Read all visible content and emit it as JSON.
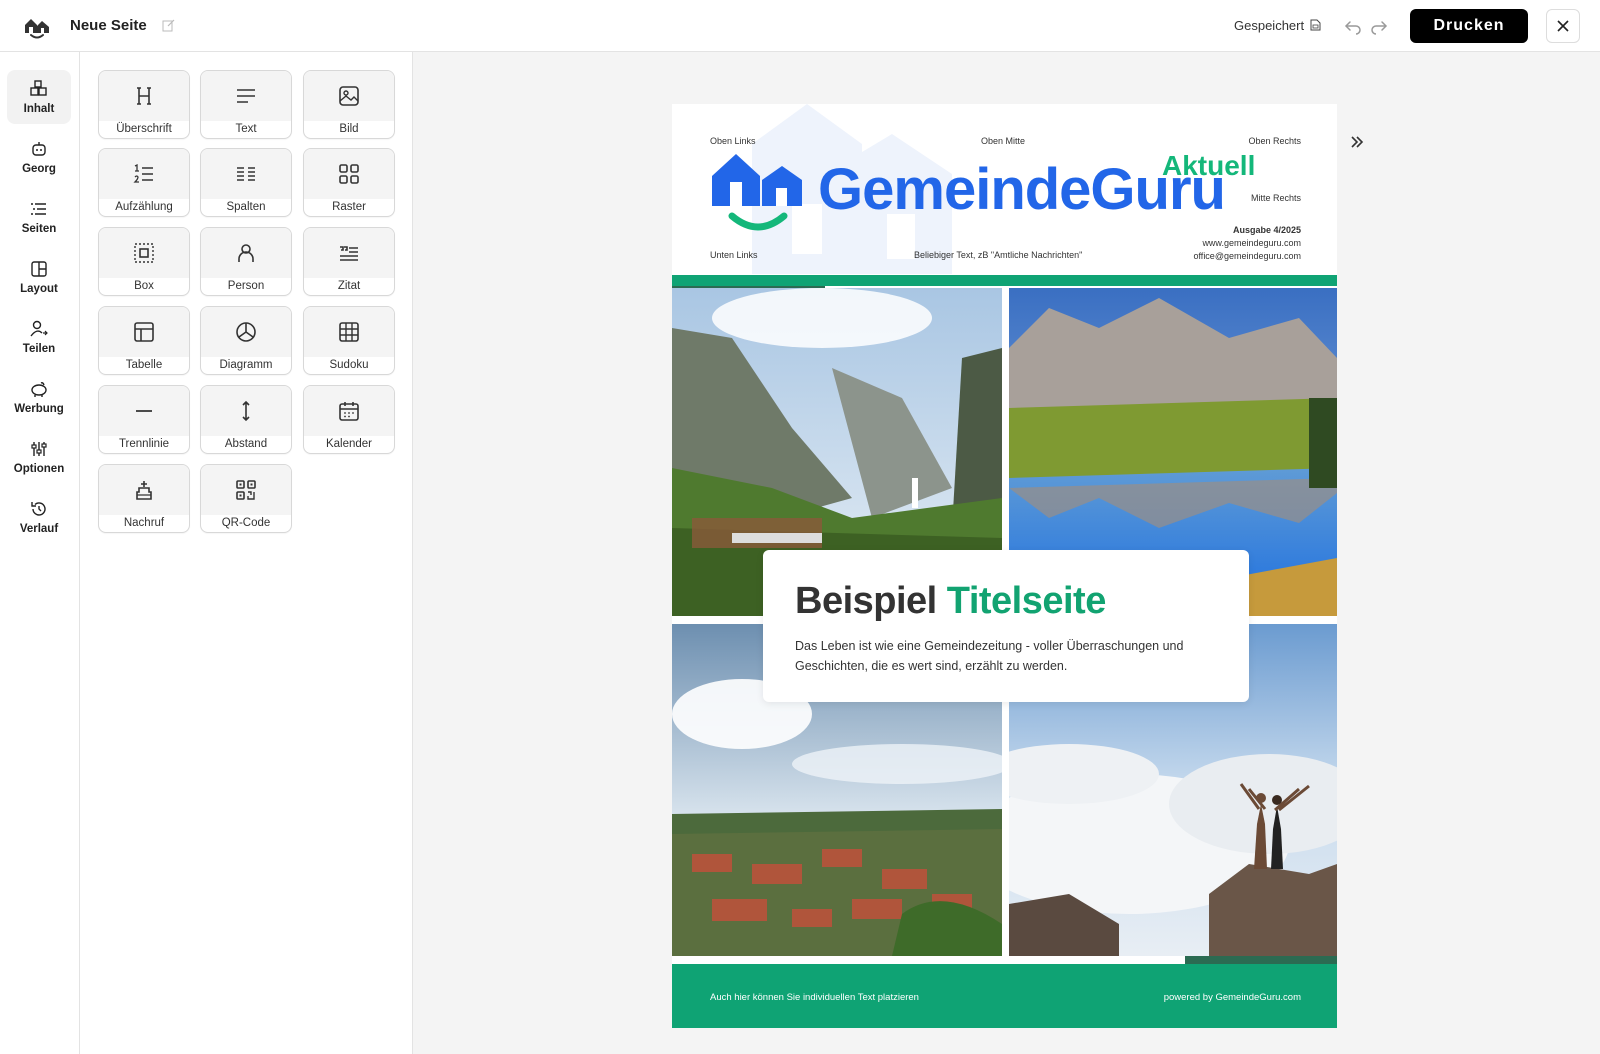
{
  "topbar": {
    "page_title": "Neue Seite",
    "saved_status": "Gespeichert",
    "print_label": "Drucken"
  },
  "rail": {
    "items": [
      {
        "label": "Inhalt",
        "icon": "blocks-icon"
      },
      {
        "label": "Georg",
        "icon": "robot-icon"
      },
      {
        "label": "Seiten",
        "icon": "list-icon"
      },
      {
        "label": "Layout",
        "icon": "layout-icon"
      },
      {
        "label": "Teilen",
        "icon": "user-share-icon"
      },
      {
        "label": "Werbung",
        "icon": "piggy-bank-icon"
      },
      {
        "label": "Optionen",
        "icon": "sliders-icon"
      },
      {
        "label": "Verlauf",
        "icon": "history-icon"
      }
    ]
  },
  "blocks": [
    {
      "label": "Überschrift",
      "icon": "heading-icon"
    },
    {
      "label": "Text",
      "icon": "text-icon"
    },
    {
      "label": "Bild",
      "icon": "image-icon"
    },
    {
      "label": "Aufzählung",
      "icon": "numbered-list-icon"
    },
    {
      "label": "Spalten",
      "icon": "columns-icon"
    },
    {
      "label": "Raster",
      "icon": "grid-icon"
    },
    {
      "label": "Box",
      "icon": "box-icon"
    },
    {
      "label": "Person",
      "icon": "person-icon"
    },
    {
      "label": "Zitat",
      "icon": "quote-icon"
    },
    {
      "label": "Tabelle",
      "icon": "table-icon"
    },
    {
      "label": "Diagramm",
      "icon": "pie-chart-icon"
    },
    {
      "label": "Sudoku",
      "icon": "sudoku-icon"
    },
    {
      "label": "Trennlinie",
      "icon": "divider-icon"
    },
    {
      "label": "Abstand",
      "icon": "spacing-icon"
    },
    {
      "label": "Kalender",
      "icon": "calendar-icon"
    },
    {
      "label": "Nachruf",
      "icon": "memorial-icon"
    },
    {
      "label": "QR-Code",
      "icon": "qr-code-icon"
    }
  ],
  "document": {
    "header": {
      "top_left": "Oben Links",
      "top_center": "Oben Mitte",
      "top_right": "Oben Rechts",
      "middle_right": "Mitte Rechts",
      "bottom_left": "Unten Links",
      "bottom_center": "Beliebiger Text, zB \"Amtliche Nachrichten\"",
      "issue": "Ausgabe 4/2025",
      "website": "www.gemeindeguru.com",
      "email": "office@gemeindeguru.com",
      "brand": "GemeindeGuru",
      "brand_suffix": "Aktuell"
    },
    "title": {
      "part1": "Beispiel",
      "part2": "Titelseite",
      "subtitle": "Das Leben ist wie eine Gemeindezeitung - voller Überraschungen und Geschichten, die es wert sind, erzählt zu werden."
    },
    "footer": {
      "left": "Auch hier können Sie individuellen Text platzieren",
      "right": "powered by GemeindeGuru.com"
    },
    "colors": {
      "brand_blue": "#2266e8",
      "brand_green": "#14b77a",
      "band_green": "#0fa374",
      "band_dark": "#2b6b52"
    }
  }
}
